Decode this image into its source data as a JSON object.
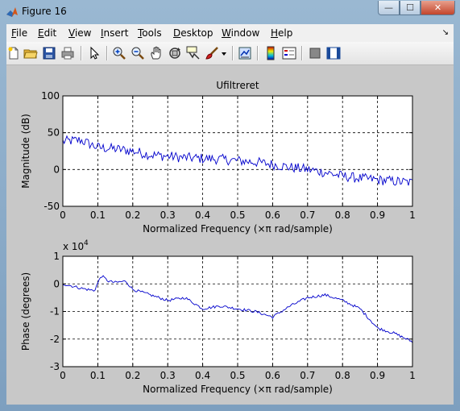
{
  "window": {
    "title": "Figure 16",
    "buttons": {
      "minimize": "—",
      "maximize": "☐",
      "close": "✕"
    }
  },
  "menubar": {
    "items": [
      {
        "label": "File",
        "key": "F",
        "rest": "ile"
      },
      {
        "label": "Edit",
        "key": "E",
        "rest": "dit"
      },
      {
        "label": "View",
        "key": "V",
        "rest": "iew"
      },
      {
        "label": "Insert",
        "key": "I",
        "rest": "nsert"
      },
      {
        "label": "Tools",
        "key": "T",
        "rest": "ools"
      },
      {
        "label": "Desktop",
        "key": "D",
        "rest": "esktop"
      },
      {
        "label": "Window",
        "key": "W",
        "rest": "indow"
      },
      {
        "label": "Help",
        "key": "H",
        "rest": "elp"
      }
    ],
    "dock_arrow": "↘"
  },
  "toolbar": {
    "icons": [
      "new-figure-icon",
      "open-file-icon",
      "save-icon",
      "print-icon",
      "edit-plot-arrow-icon",
      "zoom-in-icon",
      "zoom-out-icon",
      "pan-hand-icon",
      "rotate-3d-icon",
      "data-cursor-icon",
      "brush-icon",
      "brush-dropdown-icon",
      "link-plot-icon",
      "insert-colorbar-icon",
      "insert-legend-icon",
      "hide-plot-tools-icon",
      "show-plot-tools-icon"
    ]
  },
  "chart_data": [
    {
      "type": "line",
      "title": "Ufiltreret",
      "xlabel": "Normalized Frequency  (×π rad/sample)",
      "ylabel": "Magnitude (dB)",
      "xlim": [
        0,
        1
      ],
      "ylim": [
        -50,
        100
      ],
      "xticks": [
        "0",
        "0.1",
        "0.2",
        "0.3",
        "0.4",
        "0.5",
        "0.6",
        "0.7",
        "0.8",
        "0.9",
        "1"
      ],
      "yticks": [
        "-50",
        "0",
        "50",
        "100"
      ],
      "grid": true,
      "color": "#0000cc",
      "series": [
        {
          "x": [
            0,
            0.05,
            0.1,
            0.15,
            0.2,
            0.25,
            0.3,
            0.35,
            0.4,
            0.45,
            0.5,
            0.55,
            0.6,
            0.65,
            0.7,
            0.75,
            0.8,
            0.85,
            0.9,
            0.95,
            1.0
          ],
          "values": [
            38,
            40,
            30,
            28,
            25,
            20,
            18,
            16,
            15,
            14,
            12,
            10,
            7,
            3,
            0,
            -4,
            -9,
            -12,
            -14,
            -16,
            -18
          ],
          "noise": 7
        }
      ]
    },
    {
      "type": "line",
      "title": "",
      "exponent_label": "x 10",
      "exponent_power": "4",
      "xlabel": "Normalized Frequency  (×π rad/sample)",
      "ylabel": "Phase (degrees)",
      "xlim": [
        0,
        1
      ],
      "ylim": [
        -3,
        1
      ],
      "xticks": [
        "0",
        "0.1",
        "0.2",
        "0.3",
        "0.4",
        "0.5",
        "0.6",
        "0.7",
        "0.8",
        "0.9",
        "1"
      ],
      "yticks": [
        "-3",
        "-2",
        "-1",
        "0",
        "1"
      ],
      "grid": true,
      "color": "#0000cc",
      "series": [
        {
          "x": [
            0,
            0.05,
            0.09,
            0.11,
            0.13,
            0.15,
            0.18,
            0.2,
            0.25,
            0.3,
            0.35,
            0.4,
            0.45,
            0.5,
            0.55,
            0.6,
            0.65,
            0.7,
            0.75,
            0.8,
            0.85,
            0.9,
            0.95,
            1.0
          ],
          "values": [
            0,
            -0.15,
            -0.25,
            0.3,
            0.1,
            0.05,
            0.1,
            -0.2,
            -0.4,
            -0.6,
            -0.5,
            -0.9,
            -0.8,
            -0.9,
            -1.0,
            -1.2,
            -0.8,
            -0.5,
            -0.4,
            -0.6,
            -0.9,
            -1.6,
            -1.8,
            -2.1
          ],
          "noise": 0.05
        }
      ]
    }
  ]
}
